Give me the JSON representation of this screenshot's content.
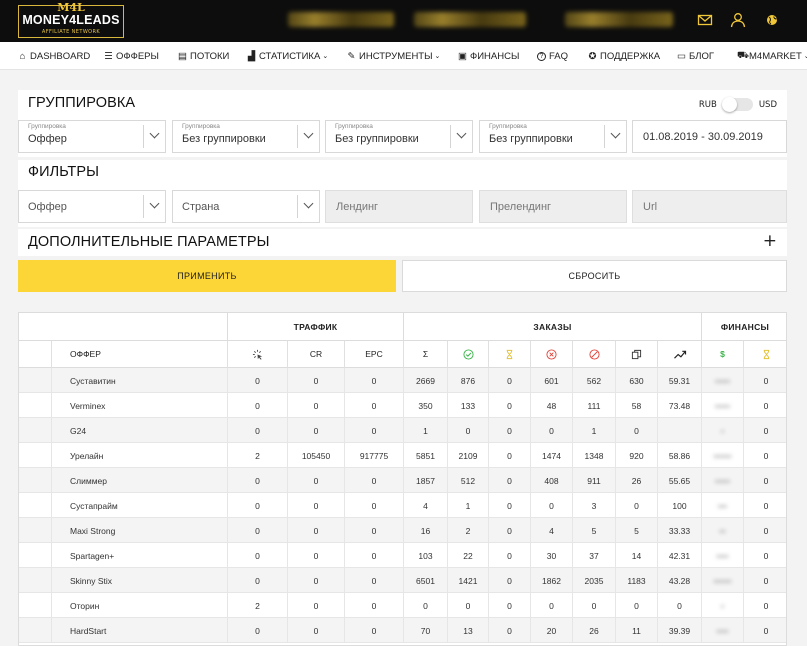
{
  "header": {
    "logo_mark": "M4L",
    "logo_text": "MONEY4LEADS",
    "logo_sub": "AFFILIATE NETWORK",
    "icons": [
      "mail-icon",
      "user-icon",
      "globe-icon"
    ]
  },
  "nav": [
    {
      "label": "DASHBOARD",
      "icon": "home-icon",
      "glyph": "⌂"
    },
    {
      "label": "ОФФЕРЫ",
      "icon": "list-icon",
      "glyph": "☰"
    },
    {
      "label": "ПОТОКИ",
      "icon": "stream-icon",
      "glyph": "▤"
    },
    {
      "label": "СТАТИСТИКА",
      "icon": "bar-chart-icon",
      "glyph": "▟",
      "dropdown": true
    },
    {
      "label": "ИНСТРУМЕНТЫ",
      "icon": "wrench-icon",
      "glyph": "✎",
      "dropdown": true
    },
    {
      "label": "ФИНАНСЫ",
      "icon": "money-icon",
      "glyph": "▣"
    },
    {
      "label": "FAQ",
      "icon": "question-icon",
      "glyph": "?"
    },
    {
      "label": "ПОДДЕРЖКА",
      "icon": "lifebuoy-icon",
      "glyph": "✪"
    },
    {
      "label": "БЛОГ",
      "icon": "blog-icon",
      "glyph": "▭"
    },
    {
      "label": "M4MARKET",
      "icon": "cart-icon",
      "glyph": "⛟",
      "dropdown": true
    }
  ],
  "grouping": {
    "title": "ГРУППИРОВКА",
    "currency_left": "RUB",
    "currency_right": "USD",
    "selects": [
      {
        "label": "Группировка",
        "value": "Оффер"
      },
      {
        "label": "Группировка",
        "value": "Без группировки"
      },
      {
        "label": "Группировка",
        "value": "Без группировки"
      },
      {
        "label": "Группировка",
        "value": "Без группировки"
      }
    ],
    "date_range": "01.08.2019 - 30.09.2019"
  },
  "filters": {
    "title": "ФИЛЬТРЫ",
    "offer": "Оффер",
    "country": "Страна",
    "landing_placeholder": "Лендинг",
    "prelanding_placeholder": "Прелендинг",
    "url_placeholder": "Url"
  },
  "extra": {
    "title": "ДОПОЛНИТЕЛЬНЫЕ ПАРАМЕТРЫ",
    "expand": "+"
  },
  "actions": {
    "apply": "ПРИМЕНИТЬ",
    "reset": "СБРОСИТЬ"
  },
  "table": {
    "groups": {
      "traffic": "ТРАФФИК",
      "orders": "ЗАКАЗЫ",
      "finance": "ФИНАНСЫ"
    },
    "headers": {
      "offer": "ОФФЕР",
      "cr": "CR",
      "epc": "EPC",
      "sum": "Σ",
      "clicks_icon": "clicks-icon",
      "approved_icon": "check-circle-icon",
      "hold_icon": "hourglass-icon",
      "rejected_icon": "x-circle-icon",
      "cancelled_icon": "cancel-circle-icon",
      "copy_icon": "copy-icon",
      "trend_icon": "trend-up-icon",
      "dollar": "$",
      "finance_hold_icon": "hourglass-icon"
    },
    "rows": [
      {
        "offer": "Суставитин",
        "clicks": "0",
        "cr": "0",
        "epc": "0",
        "sum": "2669",
        "approved": "876",
        "hold": "0",
        "rejected": "601",
        "cancelled": "562",
        "dup": "630",
        "rate": "59.31",
        "money": "•••••",
        "money_hold": "0"
      },
      {
        "offer": "Verminex",
        "clicks": "0",
        "cr": "0",
        "epc": "0",
        "sum": "350",
        "approved": "133",
        "hold": "0",
        "rejected": "48",
        "cancelled": "111",
        "dup": "58",
        "rate": "73.48",
        "money": "•••••",
        "money_hold": "0"
      },
      {
        "offer": "G24",
        "clicks": "0",
        "cr": "0",
        "epc": "0",
        "sum": "1",
        "approved": "0",
        "hold": "0",
        "rejected": "0",
        "cancelled": "1",
        "dup": "0",
        "rate": "",
        "money": "•",
        "money_hold": "0"
      },
      {
        "offer": "Урелайн",
        "clicks": "2",
        "cr": "105450",
        "epc": "917775",
        "sum": "5851",
        "approved": "2109",
        "hold": "0",
        "rejected": "1474",
        "cancelled": "1348",
        "dup": "920",
        "rate": "58.86",
        "money": "••••••",
        "money_hold": "0"
      },
      {
        "offer": "Слиммер",
        "clicks": "0",
        "cr": "0",
        "epc": "0",
        "sum": "1857",
        "approved": "512",
        "hold": "0",
        "rejected": "408",
        "cancelled": "911",
        "dup": "26",
        "rate": "55.65",
        "money": "•••••",
        "money_hold": "0"
      },
      {
        "offer": "Сустапрайм",
        "clicks": "0",
        "cr": "0",
        "epc": "0",
        "sum": "4",
        "approved": "1",
        "hold": "0",
        "rejected": "0",
        "cancelled": "3",
        "dup": "0",
        "rate": "100",
        "money": "•••",
        "money_hold": "0"
      },
      {
        "offer": "Maxi Strong",
        "clicks": "0",
        "cr": "0",
        "epc": "0",
        "sum": "16",
        "approved": "2",
        "hold": "0",
        "rejected": "4",
        "cancelled": "5",
        "dup": "5",
        "rate": "33.33",
        "money": "••",
        "money_hold": "0"
      },
      {
        "offer": "Spartagen+",
        "clicks": "0",
        "cr": "0",
        "epc": "0",
        "sum": "103",
        "approved": "22",
        "hold": "0",
        "rejected": "30",
        "cancelled": "37",
        "dup": "14",
        "rate": "42.31",
        "money": "••••",
        "money_hold": "0"
      },
      {
        "offer": "Skinny Stix",
        "clicks": "0",
        "cr": "0",
        "epc": "0",
        "sum": "6501",
        "approved": "1421",
        "hold": "0",
        "rejected": "1862",
        "cancelled": "2035",
        "dup": "1183",
        "rate": "43.28",
        "money": "••••••",
        "money_hold": "0"
      },
      {
        "offer": "Оторин",
        "clicks": "2",
        "cr": "0",
        "epc": "0",
        "sum": "0",
        "approved": "0",
        "hold": "0",
        "rejected": "0",
        "cancelled": "0",
        "dup": "0",
        "rate": "0",
        "money": "•",
        "money_hold": "0"
      },
      {
        "offer": "HardStart",
        "clicks": "0",
        "cr": "0",
        "epc": "0",
        "sum": "70",
        "approved": "13",
        "hold": "0",
        "rejected": "20",
        "cancelled": "26",
        "dup": "11",
        "rate": "39.39",
        "money": "••••",
        "money_hold": "0"
      }
    ]
  },
  "colors": {
    "accent": "#fcd537",
    "header_bg": "#0d0d0d",
    "gold": "#d8b73c",
    "approved": "#3cb44a",
    "rejected": "#e0453b",
    "hold": "#e3c23a"
  }
}
